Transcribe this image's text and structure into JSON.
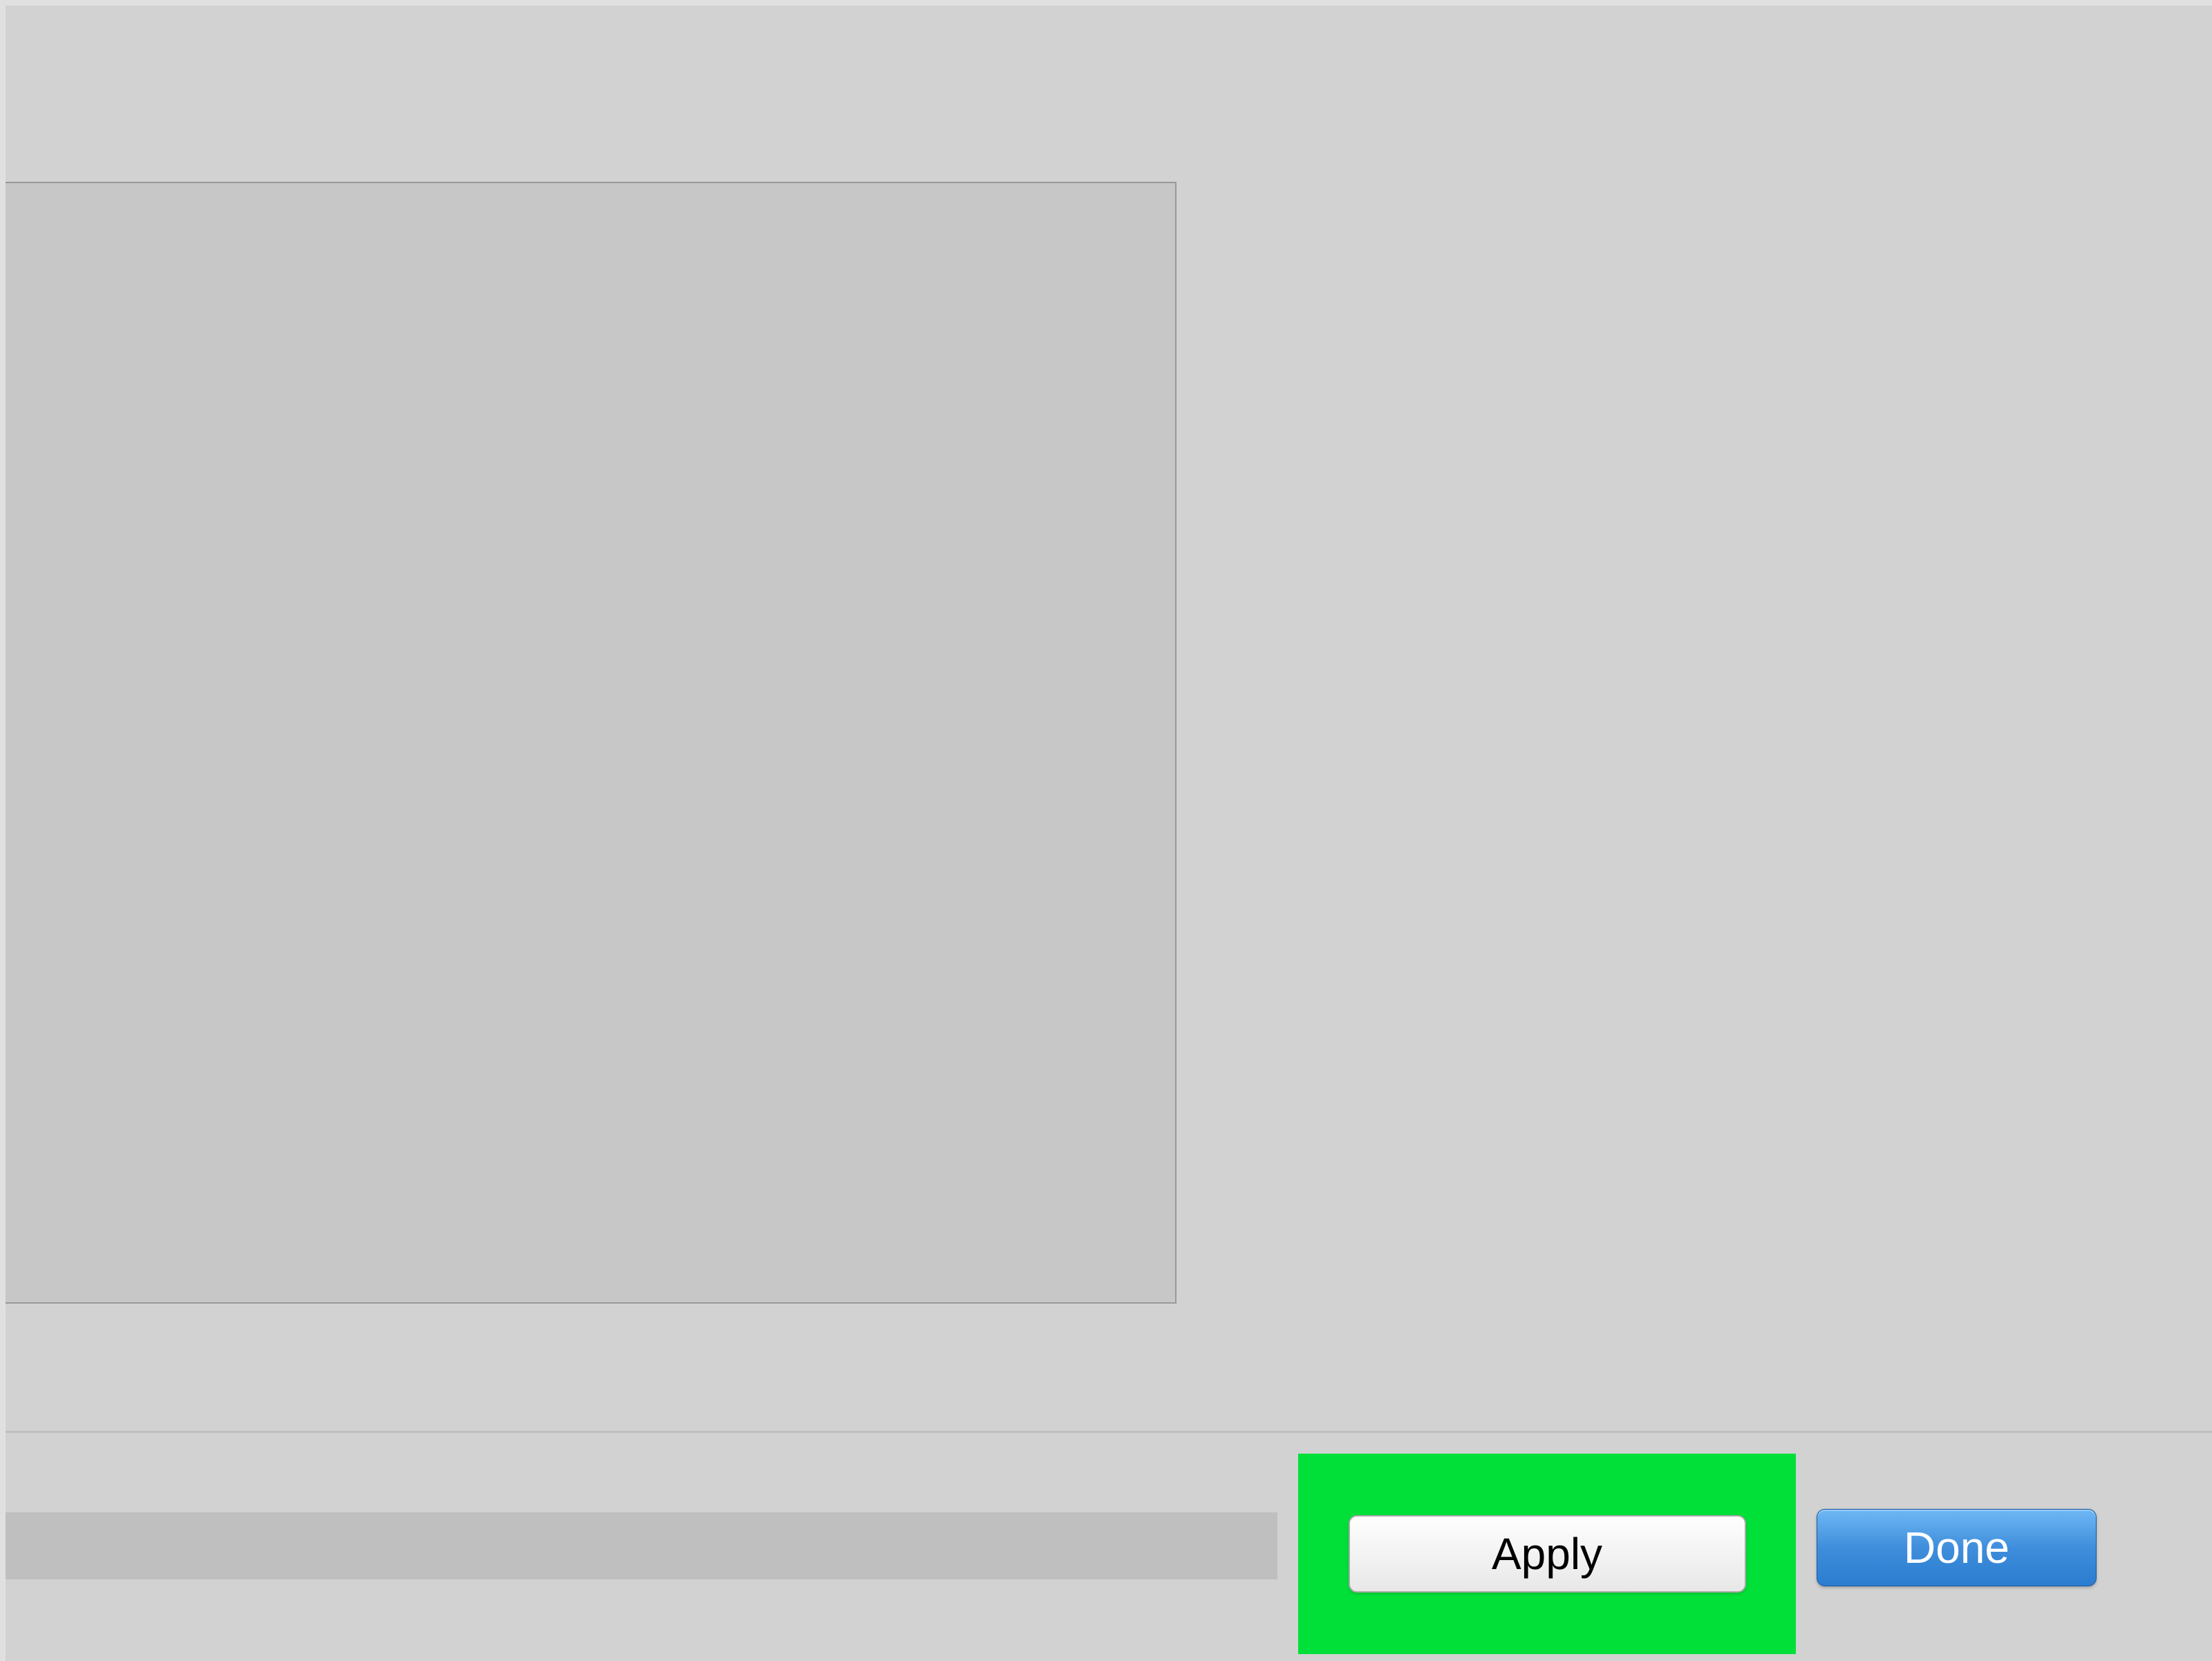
{
  "footer": {
    "apply_label": "Apply",
    "done_label": "Done"
  }
}
